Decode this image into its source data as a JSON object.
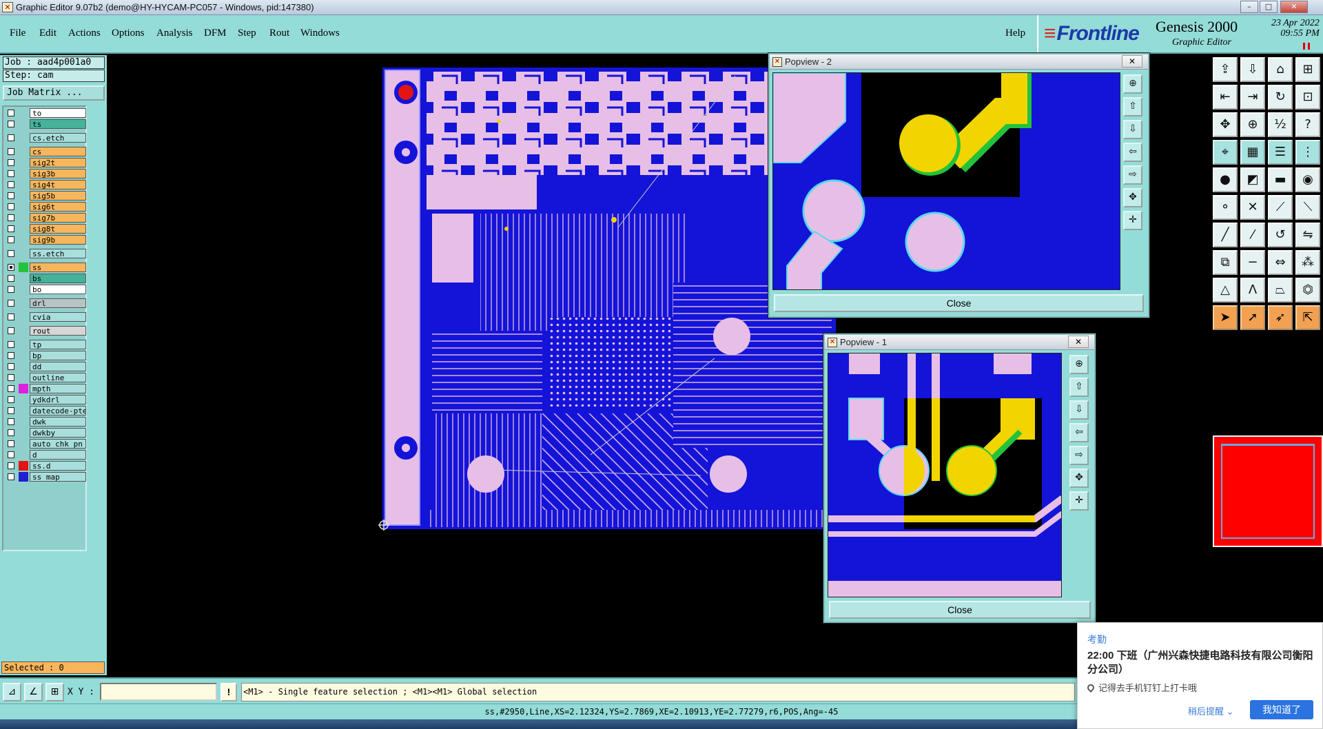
{
  "window": {
    "title": "Graphic Editor 9.07b2 (demo@HY-HYCAM-PC057 - Windows, pid:147380)",
    "controls": [
      "–",
      "□",
      "✕"
    ]
  },
  "menu": {
    "items": [
      "File",
      "Edit",
      "Actions",
      "Options",
      "Analysis",
      "DFM",
      "Step",
      "Rout",
      "Windows"
    ],
    "help": "Help"
  },
  "brand": {
    "logo": "Frontline",
    "product": "Genesis 2000",
    "subtitle": "Graphic Editor",
    "date": "23 Apr 2022",
    "time": "09:55 PM"
  },
  "job": {
    "job_line": "Job : aad4p001a0",
    "step_line": "Step: cam",
    "matrix_button": "Job Matrix ..."
  },
  "layers": [
    {
      "name": "to",
      "color": "#ffffff",
      "swatch": "",
      "checked": false
    },
    {
      "name": "ts",
      "color": "#44b39a",
      "swatch": "",
      "checked": false
    },
    {
      "name": "cs.etch",
      "color": "#a8dedb",
      "swatch": "",
      "checked": false
    },
    {
      "name": "cs",
      "color": "#f7b65c",
      "swatch": "",
      "checked": false
    },
    {
      "name": "sig2t",
      "color": "#f7b65c",
      "swatch": "",
      "checked": false
    },
    {
      "name": "sig3b",
      "color": "#f7b65c",
      "swatch": "",
      "checked": false
    },
    {
      "name": "sig4t",
      "color": "#f7b65c",
      "swatch": "",
      "checked": false
    },
    {
      "name": "sig5b",
      "color": "#f7b65c",
      "swatch": "",
      "checked": false
    },
    {
      "name": "sig6t",
      "color": "#f7b65c",
      "swatch": "",
      "checked": false
    },
    {
      "name": "sig7b",
      "color": "#f7b65c",
      "swatch": "",
      "checked": false
    },
    {
      "name": "sig8t",
      "color": "#f7b65c",
      "swatch": "",
      "checked": false
    },
    {
      "name": "sig9b",
      "color": "#f7b65c",
      "swatch": "",
      "checked": false
    },
    {
      "name": "ss.etch",
      "color": "#a8dedb",
      "swatch": "",
      "checked": false
    },
    {
      "name": "ss",
      "color": "#f7b65c",
      "swatch": "#23c23a",
      "checked": true
    },
    {
      "name": "bs",
      "color": "#44b39a",
      "swatch": "",
      "checked": false
    },
    {
      "name": "bo",
      "color": "#ffffff",
      "swatch": "",
      "checked": false
    },
    {
      "name": "drl",
      "color": "#b8c4c4",
      "swatch": "",
      "checked": false
    },
    {
      "name": "cvia",
      "color": "#a8dedb",
      "swatch": "",
      "checked": false
    },
    {
      "name": "rout",
      "color": "#d6d6d6",
      "swatch": "",
      "checked": false
    },
    {
      "name": "tp",
      "color": "#a8dedb",
      "swatch": "",
      "checked": false
    },
    {
      "name": "bp",
      "color": "#a8dedb",
      "swatch": "",
      "checked": false
    },
    {
      "name": "dd",
      "color": "#a8dedb",
      "swatch": "",
      "checked": false
    },
    {
      "name": "outline",
      "color": "#a8dedb",
      "swatch": "",
      "checked": false
    },
    {
      "name": "mpth",
      "color": "#a8dedb",
      "swatch": "#e020e0",
      "checked": false
    },
    {
      "name": "ydkdrl",
      "color": "#a8dedb",
      "swatch": "",
      "checked": false
    },
    {
      "name": "datecode-pte",
      "color": "#a8dedb",
      "swatch": "",
      "checked": false
    },
    {
      "name": "dwk",
      "color": "#a8dedb",
      "swatch": "",
      "checked": false
    },
    {
      "name": "dwkby",
      "color": "#a8dedb",
      "swatch": "",
      "checked": false
    },
    {
      "name": "auto_chk_pn",
      "color": "#a8dedb",
      "swatch": "",
      "checked": false
    },
    {
      "name": "d",
      "color": "#a8dedb",
      "swatch": "",
      "checked": false
    },
    {
      "name": "ss.d",
      "color": "#a8dedb",
      "swatch": "#e21414",
      "checked": false
    },
    {
      "name": "ss_map",
      "color": "#a8dedb",
      "swatch": "#2020d0",
      "checked": false
    }
  ],
  "selected": "Selected : 0",
  "popview2": {
    "title": "Popview - 2",
    "close": "Close"
  },
  "popview1": {
    "title": "Popview - 1",
    "close": "Close"
  },
  "bottom": {
    "xy_label": "X Y :",
    "xy_value": "",
    "hint": "<M1> - Single feature selection ; <M1><M1> Global selection",
    "status": "ss,#2950,Line,XS=2.12324,YS=2.7869,XE=2.10913,YE=2.77279,r6,POS,Ang=-45"
  },
  "notification": {
    "category": "考勤",
    "headline": "22:00 下班（广州兴森快捷电路科技有限公司衡阳分公司）",
    "body": "记得去手机钉钉上打卡哦",
    "later": "稍后提醒 ⌄",
    "ok": "我知道了"
  },
  "colors": {
    "board": "#1414d8",
    "copper": "#e7bfe6",
    "selected_pad": "#f2d500",
    "ui_teal": "#94dcd8",
    "tool_orange": "#f2a052"
  }
}
